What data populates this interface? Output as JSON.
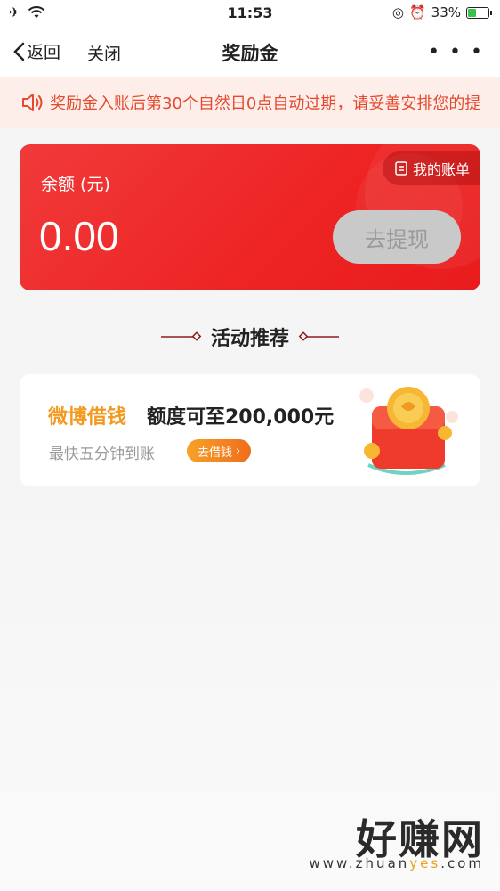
{
  "status_bar": {
    "time": "11:53",
    "battery": "33%",
    "icons": [
      "airplane-icon",
      "wifi-icon",
      "rotation-lock-icon",
      "alarm-icon",
      "battery-charging-icon"
    ]
  },
  "nav": {
    "back_label": "返回",
    "close_label": "关闭",
    "title": "奖励金",
    "more_label": "• • •"
  },
  "notice": {
    "text": "奖励金入账后第30个自然日0点自动过期，请妥善安排您的提",
    "icon": "speaker-icon"
  },
  "balance": {
    "label": "余额 (元)",
    "value": "0.00",
    "account_label": "我的账单",
    "withdraw_label": "去提现"
  },
  "section": {
    "title": "活动推荐"
  },
  "promo": {
    "brand": "微博借钱",
    "amount": "额度可至200,000元",
    "subtitle": "最快五分钟到账",
    "cta": "去借钱"
  },
  "watermark": {
    "main": "好赚网",
    "sub_prefix": "www.zhuan",
    "sub_highlight": "yes",
    "sub_suffix": ".com"
  },
  "colors": {
    "card_red": "#ee2323",
    "notice_bg": "#fdeeea",
    "notice_text": "#e54a2e",
    "brand_orange": "#f29a1f",
    "withdraw_disabled": "#c9c9c9"
  }
}
